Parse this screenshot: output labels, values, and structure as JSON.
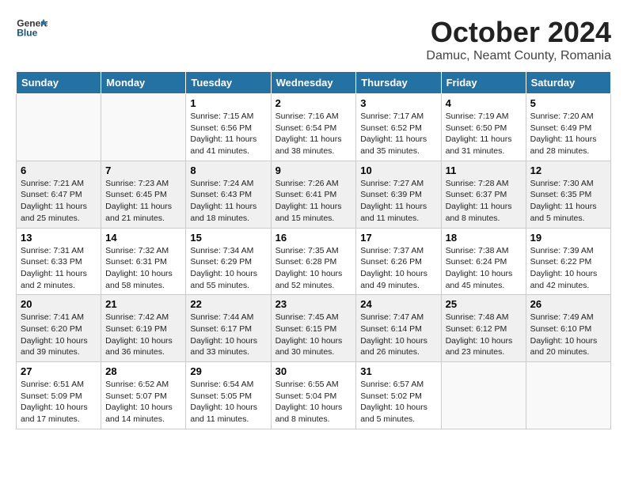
{
  "header": {
    "logo_general": "General",
    "logo_blue": "Blue",
    "month_title": "October 2024",
    "location": "Damuc, Neamt County, Romania"
  },
  "weekdays": [
    "Sunday",
    "Monday",
    "Tuesday",
    "Wednesday",
    "Thursday",
    "Friday",
    "Saturday"
  ],
  "weeks": [
    [
      {
        "day": "",
        "info": ""
      },
      {
        "day": "",
        "info": ""
      },
      {
        "day": "1",
        "info": "Sunrise: 7:15 AM\nSunset: 6:56 PM\nDaylight: 11 hours and 41 minutes."
      },
      {
        "day": "2",
        "info": "Sunrise: 7:16 AM\nSunset: 6:54 PM\nDaylight: 11 hours and 38 minutes."
      },
      {
        "day": "3",
        "info": "Sunrise: 7:17 AM\nSunset: 6:52 PM\nDaylight: 11 hours and 35 minutes."
      },
      {
        "day": "4",
        "info": "Sunrise: 7:19 AM\nSunset: 6:50 PM\nDaylight: 11 hours and 31 minutes."
      },
      {
        "day": "5",
        "info": "Sunrise: 7:20 AM\nSunset: 6:49 PM\nDaylight: 11 hours and 28 minutes."
      }
    ],
    [
      {
        "day": "6",
        "info": "Sunrise: 7:21 AM\nSunset: 6:47 PM\nDaylight: 11 hours and 25 minutes."
      },
      {
        "day": "7",
        "info": "Sunrise: 7:23 AM\nSunset: 6:45 PM\nDaylight: 11 hours and 21 minutes."
      },
      {
        "day": "8",
        "info": "Sunrise: 7:24 AM\nSunset: 6:43 PM\nDaylight: 11 hours and 18 minutes."
      },
      {
        "day": "9",
        "info": "Sunrise: 7:26 AM\nSunset: 6:41 PM\nDaylight: 11 hours and 15 minutes."
      },
      {
        "day": "10",
        "info": "Sunrise: 7:27 AM\nSunset: 6:39 PM\nDaylight: 11 hours and 11 minutes."
      },
      {
        "day": "11",
        "info": "Sunrise: 7:28 AM\nSunset: 6:37 PM\nDaylight: 11 hours and 8 minutes."
      },
      {
        "day": "12",
        "info": "Sunrise: 7:30 AM\nSunset: 6:35 PM\nDaylight: 11 hours and 5 minutes."
      }
    ],
    [
      {
        "day": "13",
        "info": "Sunrise: 7:31 AM\nSunset: 6:33 PM\nDaylight: 11 hours and 2 minutes."
      },
      {
        "day": "14",
        "info": "Sunrise: 7:32 AM\nSunset: 6:31 PM\nDaylight: 10 hours and 58 minutes."
      },
      {
        "day": "15",
        "info": "Sunrise: 7:34 AM\nSunset: 6:29 PM\nDaylight: 10 hours and 55 minutes."
      },
      {
        "day": "16",
        "info": "Sunrise: 7:35 AM\nSunset: 6:28 PM\nDaylight: 10 hours and 52 minutes."
      },
      {
        "day": "17",
        "info": "Sunrise: 7:37 AM\nSunset: 6:26 PM\nDaylight: 10 hours and 49 minutes."
      },
      {
        "day": "18",
        "info": "Sunrise: 7:38 AM\nSunset: 6:24 PM\nDaylight: 10 hours and 45 minutes."
      },
      {
        "day": "19",
        "info": "Sunrise: 7:39 AM\nSunset: 6:22 PM\nDaylight: 10 hours and 42 minutes."
      }
    ],
    [
      {
        "day": "20",
        "info": "Sunrise: 7:41 AM\nSunset: 6:20 PM\nDaylight: 10 hours and 39 minutes."
      },
      {
        "day": "21",
        "info": "Sunrise: 7:42 AM\nSunset: 6:19 PM\nDaylight: 10 hours and 36 minutes."
      },
      {
        "day": "22",
        "info": "Sunrise: 7:44 AM\nSunset: 6:17 PM\nDaylight: 10 hours and 33 minutes."
      },
      {
        "day": "23",
        "info": "Sunrise: 7:45 AM\nSunset: 6:15 PM\nDaylight: 10 hours and 30 minutes."
      },
      {
        "day": "24",
        "info": "Sunrise: 7:47 AM\nSunset: 6:14 PM\nDaylight: 10 hours and 26 minutes."
      },
      {
        "day": "25",
        "info": "Sunrise: 7:48 AM\nSunset: 6:12 PM\nDaylight: 10 hours and 23 minutes."
      },
      {
        "day": "26",
        "info": "Sunrise: 7:49 AM\nSunset: 6:10 PM\nDaylight: 10 hours and 20 minutes."
      }
    ],
    [
      {
        "day": "27",
        "info": "Sunrise: 6:51 AM\nSunset: 5:09 PM\nDaylight: 10 hours and 17 minutes."
      },
      {
        "day": "28",
        "info": "Sunrise: 6:52 AM\nSunset: 5:07 PM\nDaylight: 10 hours and 14 minutes."
      },
      {
        "day": "29",
        "info": "Sunrise: 6:54 AM\nSunset: 5:05 PM\nDaylight: 10 hours and 11 minutes."
      },
      {
        "day": "30",
        "info": "Sunrise: 6:55 AM\nSunset: 5:04 PM\nDaylight: 10 hours and 8 minutes."
      },
      {
        "day": "31",
        "info": "Sunrise: 6:57 AM\nSunset: 5:02 PM\nDaylight: 10 hours and 5 minutes."
      },
      {
        "day": "",
        "info": ""
      },
      {
        "day": "",
        "info": ""
      }
    ]
  ]
}
